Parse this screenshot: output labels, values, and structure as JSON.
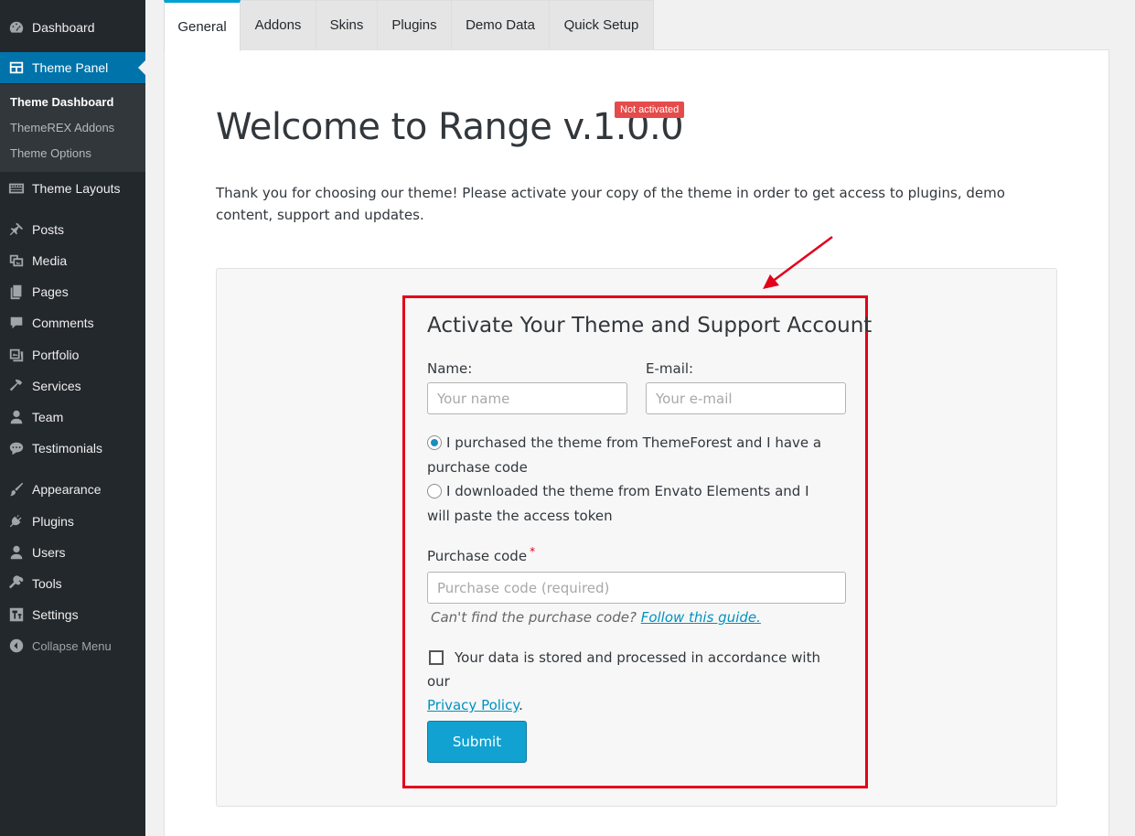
{
  "sidebar": {
    "items": [
      {
        "label": "Dashboard",
        "icon": "dashboard-icon"
      },
      {
        "label": "Theme Panel",
        "icon": "theme-panel-icon"
      },
      {
        "label": "Theme Layouts",
        "icon": "layouts-icon"
      },
      {
        "label": "Posts",
        "icon": "pin-icon"
      },
      {
        "label": "Media",
        "icon": "media-icon"
      },
      {
        "label": "Pages",
        "icon": "pages-icon"
      },
      {
        "label": "Comments",
        "icon": "comment-icon"
      },
      {
        "label": "Portfolio",
        "icon": "portfolio-icon"
      },
      {
        "label": "Services",
        "icon": "hammer-icon"
      },
      {
        "label": "Team",
        "icon": "user-icon"
      },
      {
        "label": "Testimonials",
        "icon": "testimonial-icon"
      },
      {
        "label": "Appearance",
        "icon": "brush-icon"
      },
      {
        "label": "Plugins",
        "icon": "plugin-icon"
      },
      {
        "label": "Users",
        "icon": "users-icon"
      },
      {
        "label": "Tools",
        "icon": "wrench-icon"
      },
      {
        "label": "Settings",
        "icon": "settings-icon"
      },
      {
        "label": "Collapse Menu",
        "icon": "collapse-icon"
      }
    ],
    "submenu": [
      "Theme Dashboard",
      "ThemeREX Addons",
      "Theme Options"
    ]
  },
  "tabs": [
    "General",
    "Addons",
    "Skins",
    "Plugins",
    "Demo Data",
    "Quick Setup"
  ],
  "main": {
    "title": "Welcome to Range v.1.0.0",
    "status_badge": "Not activated",
    "intro": "Thank you for choosing our theme! Please activate your copy of the theme in order to get access to plugins, demo content, support and updates."
  },
  "form": {
    "title": "Activate Your Theme and Support Account",
    "name_label": "Name:",
    "name_placeholder": "Your name",
    "email_label": "E-mail:",
    "email_placeholder": "Your e-mail",
    "radio_themeforest": "I purchased the theme from ThemeForest and I have a purchase code",
    "radio_envato": "I downloaded the theme from Envato Elements and I will paste the access token",
    "purchase_label": "Purchase code",
    "required_mark": "*",
    "purchase_placeholder": "Purchase code (required)",
    "hint_text": "Can't find the purchase code?",
    "hint_link": "Follow this guide.",
    "consent_text": "Your data is stored and processed in accordance with our",
    "consent_link": "Privacy Policy",
    "consent_end": ".",
    "submit_label": "Submit"
  },
  "colors": {
    "sidebar_bg": "#23282d",
    "accent": "#0073aa",
    "highlight": "#e3001b",
    "button": "#11a2d2"
  }
}
